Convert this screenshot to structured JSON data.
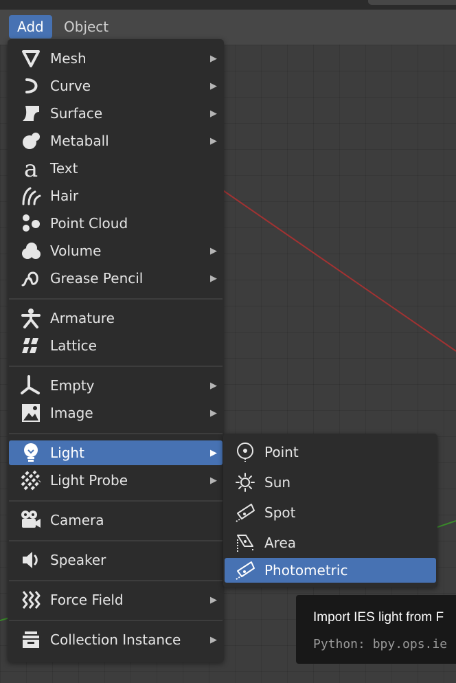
{
  "header": {
    "menus": [
      {
        "label": "Add",
        "active": true
      },
      {
        "label": "Object",
        "active": false
      }
    ]
  },
  "add_menu": {
    "items": [
      {
        "label": "Mesh",
        "icon": "mesh-icon",
        "submenu": true
      },
      {
        "label": "Curve",
        "icon": "curve-icon",
        "submenu": true
      },
      {
        "label": "Surface",
        "icon": "surface-icon",
        "submenu": true
      },
      {
        "label": "Metaball",
        "icon": "metaball-icon",
        "submenu": true
      },
      {
        "label": "Text",
        "icon": "text-icon",
        "submenu": false
      },
      {
        "label": "Hair",
        "icon": "hair-icon",
        "submenu": false
      },
      {
        "label": "Point Cloud",
        "icon": "point-cloud-icon",
        "submenu": false
      },
      {
        "label": "Volume",
        "icon": "volume-icon",
        "submenu": true
      },
      {
        "label": "Grease Pencil",
        "icon": "grease-pencil-icon",
        "submenu": true
      },
      {
        "label": "Armature",
        "icon": "armature-icon",
        "submenu": false
      },
      {
        "label": "Lattice",
        "icon": "lattice-icon",
        "submenu": false
      },
      {
        "label": "Empty",
        "icon": "empty-icon",
        "submenu": true
      },
      {
        "label": "Image",
        "icon": "image-icon",
        "submenu": true
      },
      {
        "label": "Light",
        "icon": "light-bulb-icon",
        "submenu": true,
        "active": true
      },
      {
        "label": "Light Probe",
        "icon": "light-probe-icon",
        "submenu": true
      },
      {
        "label": "Camera",
        "icon": "camera-icon",
        "submenu": false
      },
      {
        "label": "Speaker",
        "icon": "speaker-icon",
        "submenu": false
      },
      {
        "label": "Force Field",
        "icon": "force-field-icon",
        "submenu": true
      },
      {
        "label": "Collection Instance",
        "icon": "collection-instance-icon",
        "submenu": true
      }
    ],
    "submenu_arrow": "▶"
  },
  "light_submenu": {
    "items": [
      {
        "label": "Point",
        "icon": "point-light-icon"
      },
      {
        "label": "Sun",
        "icon": "sun-light-icon"
      },
      {
        "label": "Spot",
        "icon": "spot-light-icon"
      },
      {
        "label": "Area",
        "icon": "area-light-icon"
      },
      {
        "label": "Photometric",
        "icon": "photometric-light-icon",
        "active": true
      }
    ]
  },
  "tooltip": {
    "title": "Import IES light from F",
    "python": "Python: bpy.ops.ie"
  },
  "colors": {
    "accent": "#4772b3",
    "menu_bg": "#2c2c2c",
    "header_bg": "#474747",
    "viewport_bg": "#3d3d3d",
    "x_axis": "#b03030",
    "y_axis": "#3a8a2a"
  }
}
